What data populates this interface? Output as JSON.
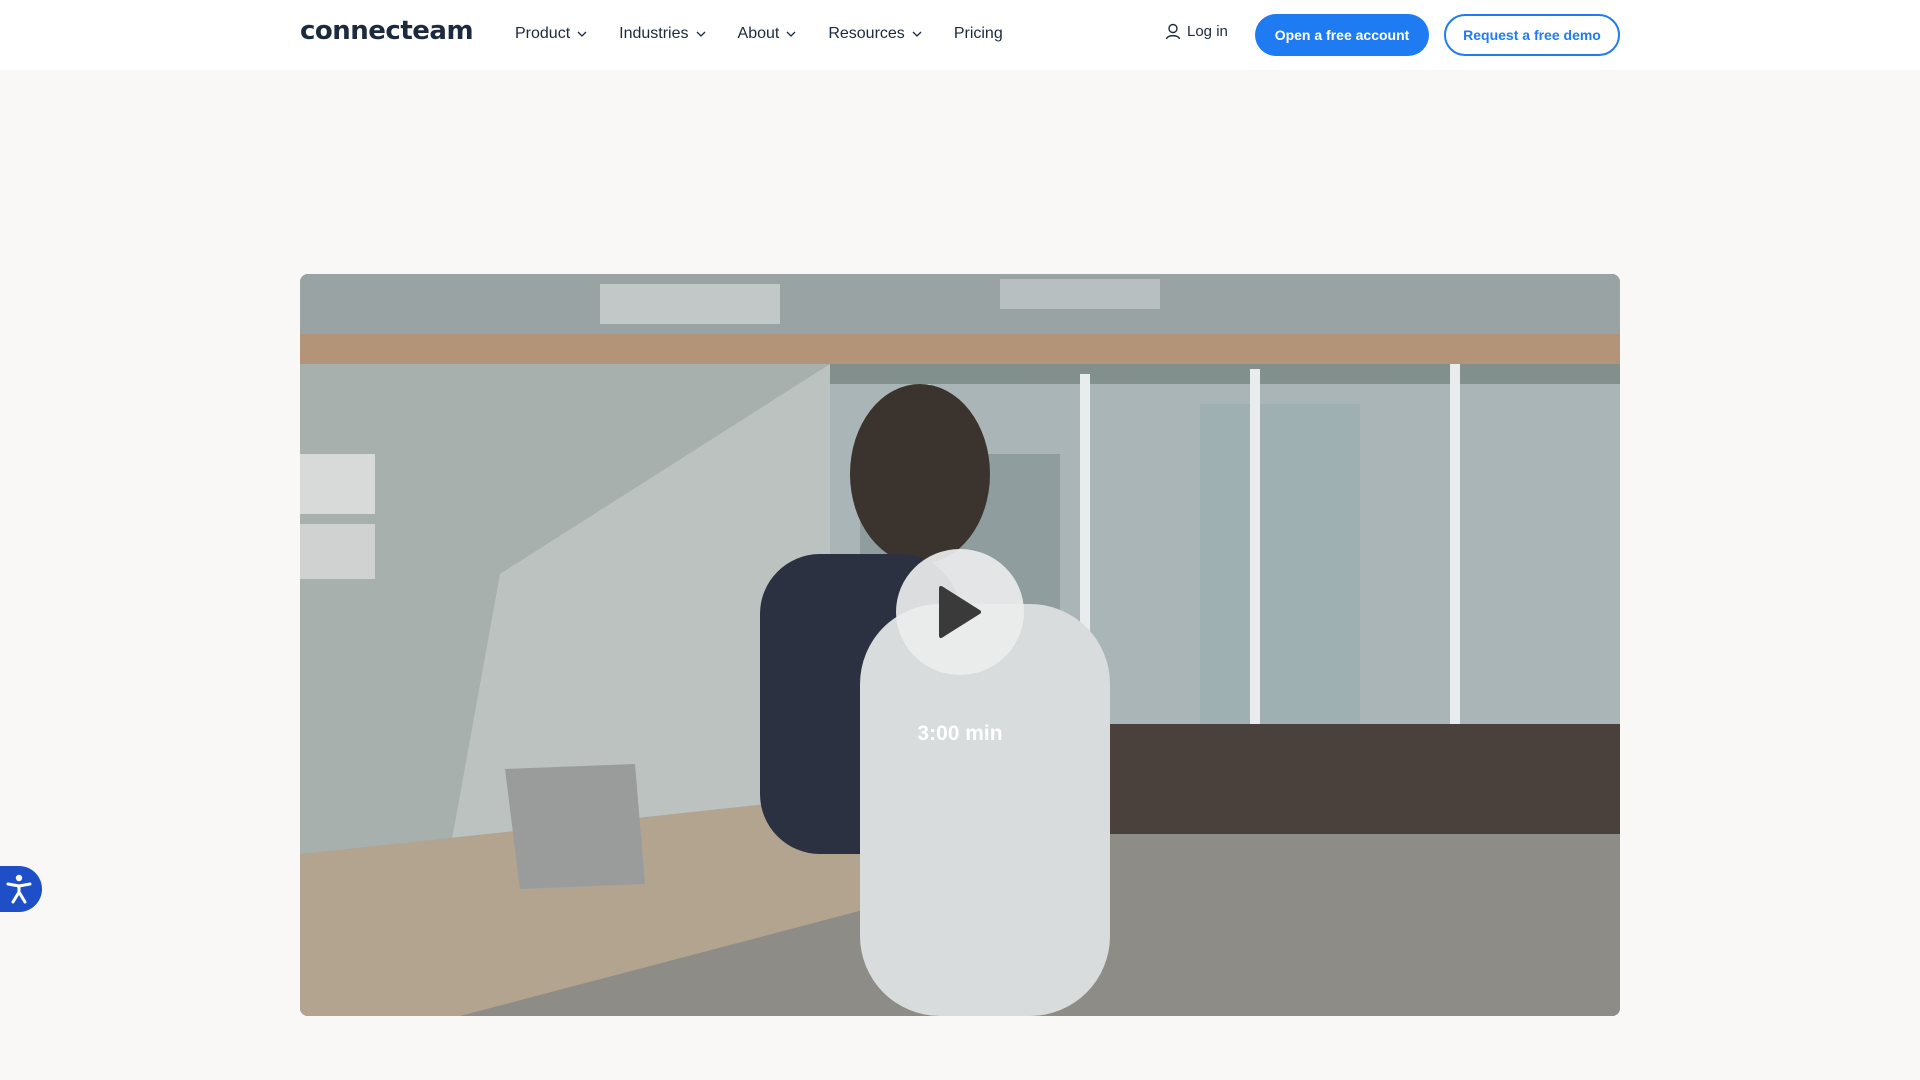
{
  "header": {
    "logo": "connecteam",
    "nav": [
      {
        "label": "Product",
        "dropdown": true
      },
      {
        "label": "Industries",
        "dropdown": true
      },
      {
        "label": "About",
        "dropdown": true
      },
      {
        "label": "Resources",
        "dropdown": true
      },
      {
        "label": "Pricing",
        "dropdown": false
      }
    ],
    "login_label": "Log in",
    "primary_cta": "Open a free account",
    "secondary_cta": "Request a free demo"
  },
  "video": {
    "duration": "3:00 min",
    "icon": "play-icon"
  },
  "accessibility": {
    "icon": "accessibility-icon"
  },
  "colors": {
    "brand_blue": "#1e7bf2",
    "text_dark": "#1b2a3d",
    "page_bg": "#f9f8f6",
    "accessibility_blue": "#1e4fc7"
  }
}
